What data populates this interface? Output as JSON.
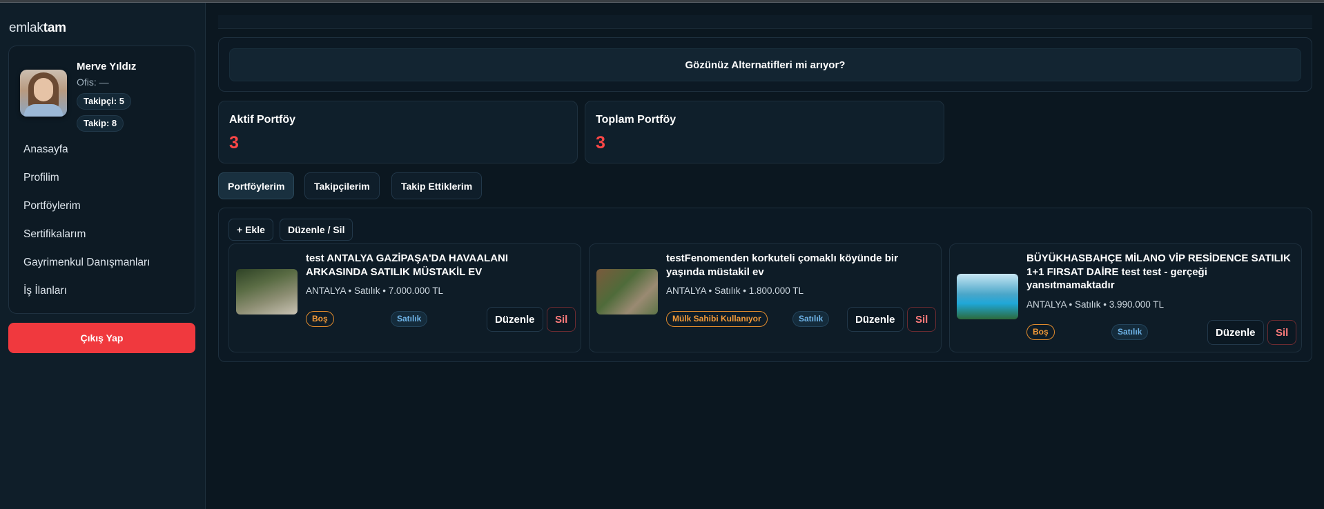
{
  "logo": {
    "light": "emlak",
    "bold": "tam"
  },
  "profile": {
    "name": "Merve Yıldız",
    "office": "Ofis: —",
    "followers_chip": "Takipçi: 5",
    "following_chip": "Takip: 8"
  },
  "nav": [
    "Anasayfa",
    "Profilim",
    "Portföylerim",
    "Sertifikalarım",
    "Gayrimenkul Danışmanları",
    "İş İlanları"
  ],
  "logout_label": "Çıkış Yap",
  "alternatives_button": "Gözünüz Alternatifleri mi arıyor?",
  "stats": [
    {
      "label": "Aktif Portföy",
      "value": "3"
    },
    {
      "label": "Toplam Portföy",
      "value": "3"
    }
  ],
  "tabs": [
    "Portföylerim",
    "Takipçilerim",
    "Takip Ettiklerim"
  ],
  "active_tab": "Portföylerim",
  "panel_actions": {
    "add": "+ Ekle",
    "edit_delete": "Düzenle / Sil"
  },
  "listings": [
    {
      "title": "test ANTALYA GAZİPAŞA'DA HAVAALANI ARKASINDA SATILIK MÜSTAKİL EV",
      "meta": "ANTALYA • Satılık • 7.000.000 TL",
      "status_badge": "Boş",
      "type_badge": "Satılık",
      "edit": "Düzenle",
      "delete": "Sil"
    },
    {
      "title": "testFenomenden korkuteli çomaklı köyünde bir yaşında müstakil ev",
      "meta": "ANTALYA • Satılık • 1.800.000 TL",
      "status_badge": "Mülk Sahibi Kullanıyor",
      "type_badge": "Satılık",
      "edit": "Düzenle",
      "delete": "Sil"
    },
    {
      "title": "BÜYÜKHASBAHÇE MİLANO VİP RESİDENCE SATILIK 1+1 FIRSAT DAİRE test test - gerçeği yansıtmamaktadır",
      "meta": "ANTALYA • Satılık • 3.990.000 TL",
      "status_badge": "Boş",
      "type_badge": "Satılık",
      "edit": "Düzenle",
      "delete": "Sil"
    }
  ],
  "colors": {
    "accent_red": "#f0393e",
    "value_red": "#ff4747",
    "badge_orange": "#f39a38",
    "badge_blue": "#6fb4e8",
    "background": "#0b1720"
  }
}
